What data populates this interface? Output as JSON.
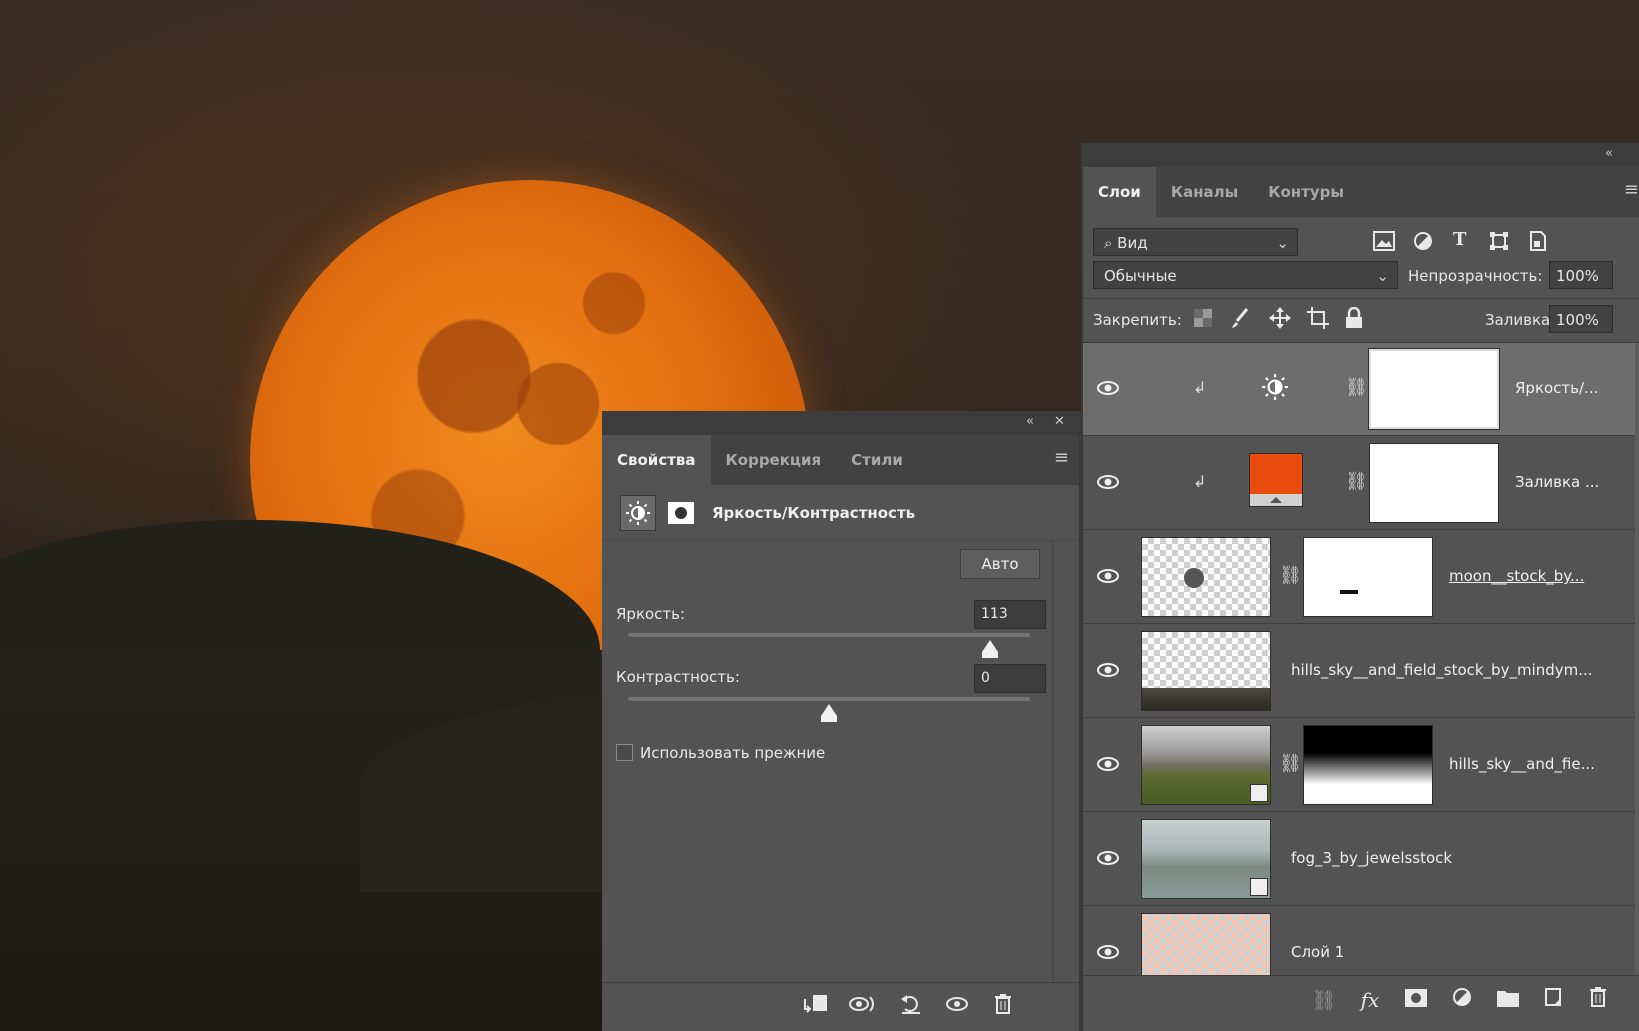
{
  "properties_panel": {
    "tabs": [
      "Свойства",
      "Коррекция",
      "Стили"
    ],
    "title": "Яркость/Контрастность",
    "auto_label": "Авто",
    "brightness_label": "Яркость:",
    "brightness_value": "113",
    "brightness_level": 0.9,
    "contrast_label": "Контрастность:",
    "contrast_value": "0",
    "contrast_level": 0.5,
    "legacy_label": "Использовать прежние",
    "legacy_checked": false
  },
  "layers_panel": {
    "tabs": [
      "Слои",
      "Каналы",
      "Контуры"
    ],
    "filter_label": "Вид",
    "blend_mode": "Обычные",
    "opacity_label": "Непрозрачность:",
    "opacity_value": "100%",
    "lock_label": "Закрепить:",
    "fill_label": "Заливка:",
    "fill_value": "100%",
    "layers": [
      {
        "name": "Яркость/..."
      },
      {
        "name": "Заливка ..."
      },
      {
        "name": "moon__stock_by..."
      },
      {
        "name": "hills_sky__and_field_stock_by_mindym..."
      },
      {
        "name": "hills_sky__and_fie..."
      },
      {
        "name": "fog_3_by_jewelsstock"
      },
      {
        "name": "Слой 1"
      }
    ]
  },
  "colors": {
    "panel_bg": "#535353",
    "tab_bar": "#424242",
    "selected_layer": "#6d6d6d",
    "fill_swatch": "#e84c0c",
    "moon": "#e3700f"
  }
}
